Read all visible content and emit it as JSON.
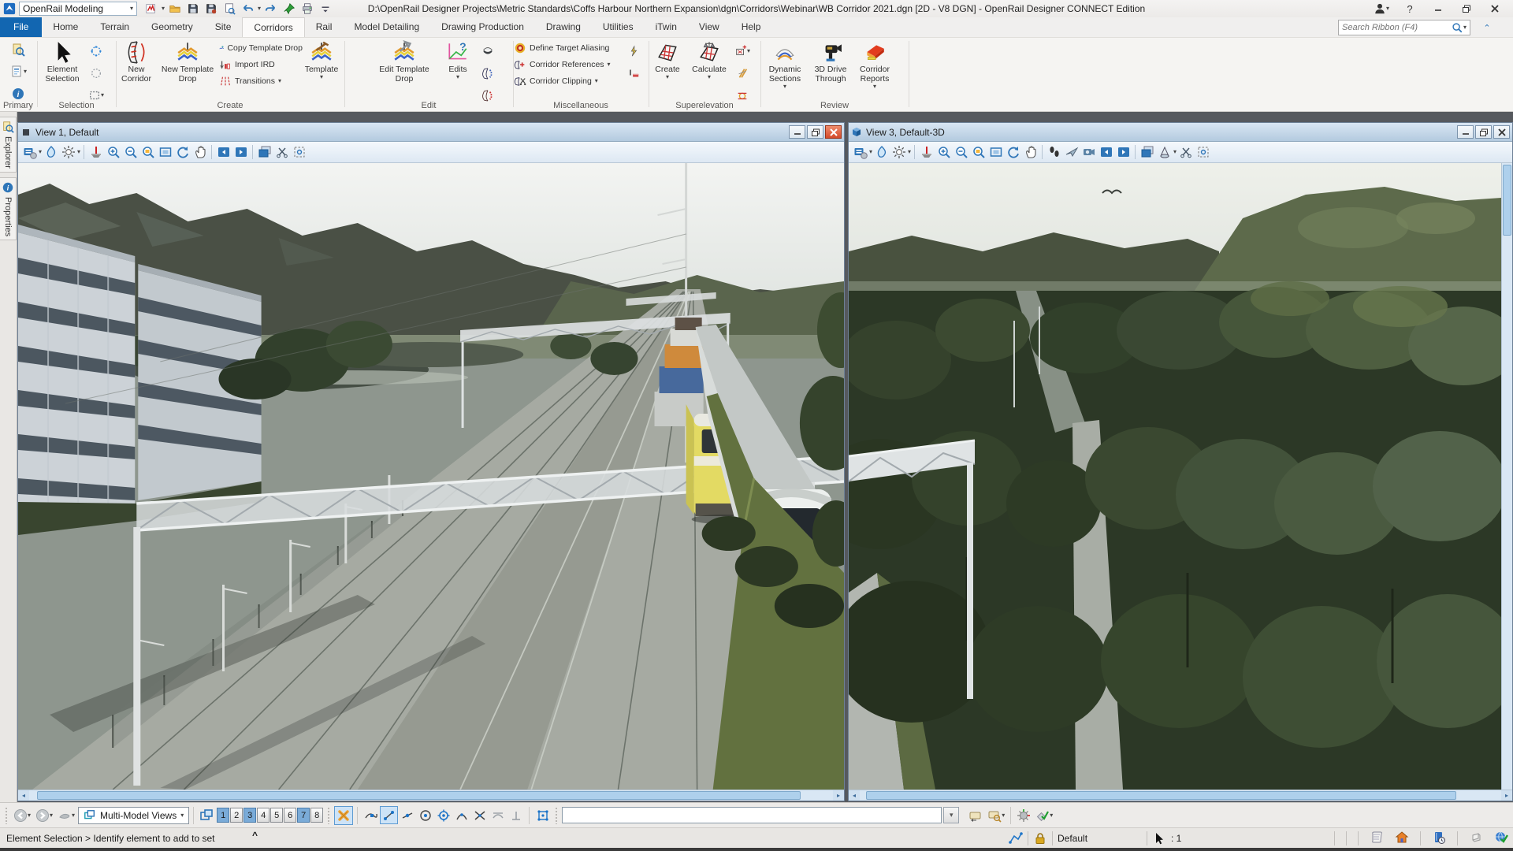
{
  "titlebar": {
    "workflow": "OpenRail Modeling",
    "title": "D:\\OpenRail Designer Projects\\Metric Standards\\Coffs Harbour Northern Expansion\\dgn\\Corridors\\Webinar\\WB Corridor 2021.dgn [2D - V8 DGN] - OpenRail Designer CONNECT Edition",
    "help_label": "?",
    "quick_access": [
      "wset",
      "caret",
      "folder",
      "save",
      "savegear",
      "printpre",
      "undo",
      "caret",
      "redo",
      "pin",
      "printer",
      "qmore"
    ]
  },
  "tabs": {
    "items": [
      {
        "label": "File",
        "file": true
      },
      {
        "label": "Home"
      },
      {
        "label": "Terrain"
      },
      {
        "label": "Geometry"
      },
      {
        "label": "Site"
      },
      {
        "label": "Corridors",
        "active": true
      },
      {
        "label": "Rail"
      },
      {
        "label": "Model Detailing"
      },
      {
        "label": "Drawing Production"
      },
      {
        "label": "Drawing"
      },
      {
        "label": "Utilities"
      },
      {
        "label": "iTwin"
      },
      {
        "label": "View"
      },
      {
        "label": "Help"
      }
    ]
  },
  "search": {
    "placeholder": "Search Ribbon (F4)"
  },
  "ribbon": {
    "groups": [
      "Primary",
      "Selection",
      "Create",
      "Edit",
      "Miscellaneous",
      "Superelevation",
      "Review"
    ],
    "element_selection": "Element Selection",
    "new_corridor": "New Corridor",
    "new_template_drop": "New Template Drop",
    "copy_template_drop": "Copy Template Drop",
    "import_ird": "Import IRD",
    "transitions": "Transitions",
    "template": "Template",
    "edit_template_drop": "Edit Template Drop",
    "edits": "Edits",
    "define_target_aliasing": "Define Target Aliasing",
    "corridor_references": "Corridor References",
    "corridor_clipping": "Corridor Clipping",
    "create": "Create",
    "calculate": "Calculate",
    "dynamic_sections": "Dynamic Sections",
    "drive_through": "3D Drive Through",
    "corridor_reports": "Corridor Reports"
  },
  "dock": {
    "explorer": "Explorer",
    "properties": "Properties"
  },
  "views": {
    "view1": {
      "title": "View 1, Default",
      "toolbar": [
        "va",
        "caret",
        "dstyle",
        "sun",
        "caret",
        "sep",
        "stamp",
        "zin",
        "zout",
        "zwin",
        "fit",
        "rot",
        "pan",
        "sep",
        "vprev",
        "vnext",
        "sep",
        "copyview",
        "scis",
        "cmask"
      ]
    },
    "view3": {
      "title": "View 3, Default-3D",
      "toolbar": [
        "va",
        "caret",
        "dstyle",
        "sun",
        "caret",
        "sep",
        "stamp",
        "zin",
        "zout",
        "zwin",
        "fit",
        "rot",
        "pan",
        "sep",
        "walk",
        "fly",
        "cam",
        "vprev",
        "vnext",
        "sep",
        "copyview",
        "cone",
        "caret",
        "scis",
        "cmask"
      ]
    }
  },
  "bottombar": {
    "multi_model_views": "Multi-Model Views",
    "view_numbers": [
      "1",
      "2",
      "3",
      "4",
      "5",
      "6",
      "7",
      "8"
    ],
    "active_views": [
      0,
      2,
      6
    ],
    "snaps": [
      "snap-near",
      "snap-key",
      "snap-mid",
      "snap-center",
      "snap-origin",
      "snap-bisector",
      "snap-int",
      "snap-tan",
      "snap-perp"
    ],
    "active_snap": 1
  },
  "statusbar": {
    "message": "Element Selection > Identify element to add to set",
    "marker": "^",
    "active_level": "Default",
    "selection_count": ": 1",
    "right_icons": [
      "sep",
      "sep",
      "sep",
      "sb-scroll",
      "sb-home",
      "sep",
      "sb-notes",
      "sep",
      "sb-cube",
      "sb-globe"
    ]
  }
}
